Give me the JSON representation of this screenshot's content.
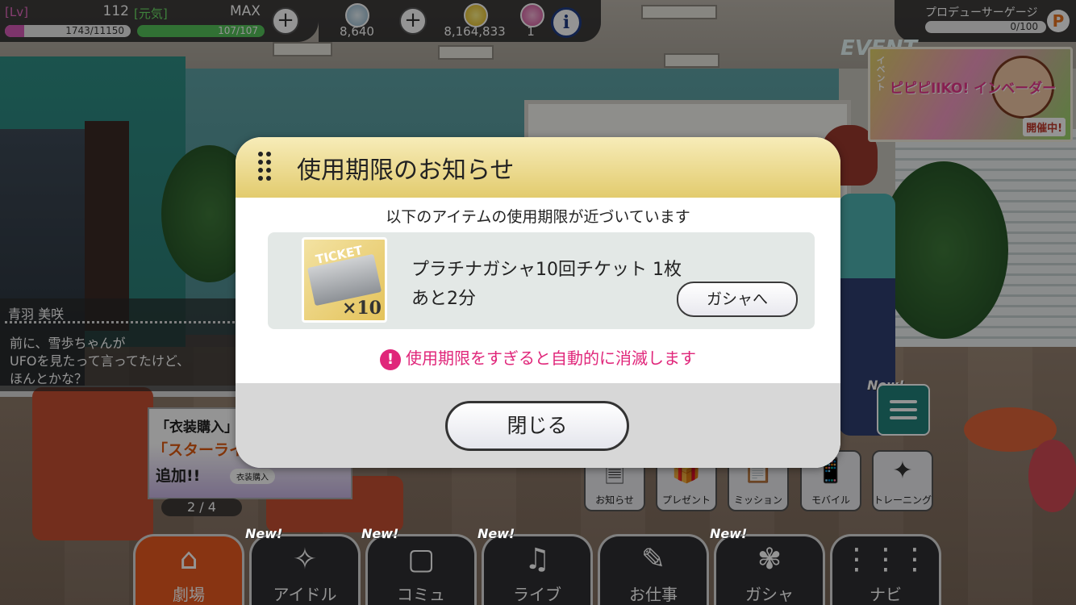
{
  "status": {
    "lv_label": "[Lv]",
    "lv_value": "112",
    "exp_text": "1743/11150",
    "exp_fraction": 0.156,
    "genki_label": "[元気]",
    "genki_max": "MAX",
    "stamina_text": "107/107",
    "stamina_fraction": 1.0
  },
  "currency": {
    "gems": "8,640",
    "money": "8,164,833",
    "tickets": "1"
  },
  "producer": {
    "label": "プロデューサーゲージ",
    "value": "0/100",
    "badge": "P"
  },
  "event": {
    "tag": "EVENT",
    "vertical": "イベント",
    "title": "ピピピIIKO! インベーダー",
    "status": "開催中!"
  },
  "dialogue": {
    "speaker": "青羽 美咲",
    "lines": [
      "前に、雪歩ちゃんが",
      "UFOを見たって言ってたけど、",
      "ほんとかな？"
    ]
  },
  "costume_banner": {
    "line1": "「衣装購入」",
    "line2": "「スターライト",
    "line3": "追加!!",
    "small": "衣装購入"
  },
  "page_indicator": "2 / 4",
  "side_buttons": [
    {
      "label": "お知らせ",
      "icon": "notice-icon",
      "glyph": "🗎"
    },
    {
      "label": "プレゼント",
      "icon": "present-icon",
      "glyph": "🎁"
    },
    {
      "label": "ミッション",
      "icon": "mission-icon",
      "glyph": "📋"
    },
    {
      "label": "モバイル",
      "icon": "mobile-icon",
      "glyph": "📱"
    },
    {
      "label": "トレーニング",
      "icon": "training-icon",
      "glyph": "✦"
    }
  ],
  "new_label": "New!",
  "nav": [
    {
      "label": "劇場",
      "icon": "theater-icon",
      "glyph": "⌂",
      "active": true,
      "new": false
    },
    {
      "label": "アイドル",
      "icon": "idol-icon",
      "glyph": "✧",
      "active": false,
      "new": true
    },
    {
      "label": "コミュ",
      "icon": "commu-icon",
      "glyph": "▢",
      "active": false,
      "new": true
    },
    {
      "label": "ライブ",
      "icon": "live-icon",
      "glyph": "♫",
      "active": false,
      "new": true
    },
    {
      "label": "お仕事",
      "icon": "work-icon",
      "glyph": "✎",
      "active": false,
      "new": false
    },
    {
      "label": "ガシャ",
      "icon": "gacha-icon",
      "glyph": "✾",
      "active": false,
      "new": true
    },
    {
      "label": "ナビ",
      "icon": "navi-icon",
      "glyph": "⋮⋮⋮",
      "active": false,
      "new": false
    }
  ],
  "modal": {
    "title": "使用期限のお知らせ",
    "subtitle": "以下のアイテムの使用期限が近づいています",
    "item_name": "プラチナガシャ10回チケット 1枚",
    "item_time": "あと2分",
    "ticket_word": "TICKET",
    "ticket_qty": "×10",
    "gacha_button": "ガシャへ",
    "warning": "使用期限をすぎると自動的に消滅します",
    "close_button": "閉じる"
  },
  "colors": {
    "accent_pink": "#e0267a",
    "nav_active": "#ea5b1f",
    "exp_bar": "#d75ab8",
    "stamina_bar": "#55c35a",
    "modal_header": "#e9d47c"
  }
}
